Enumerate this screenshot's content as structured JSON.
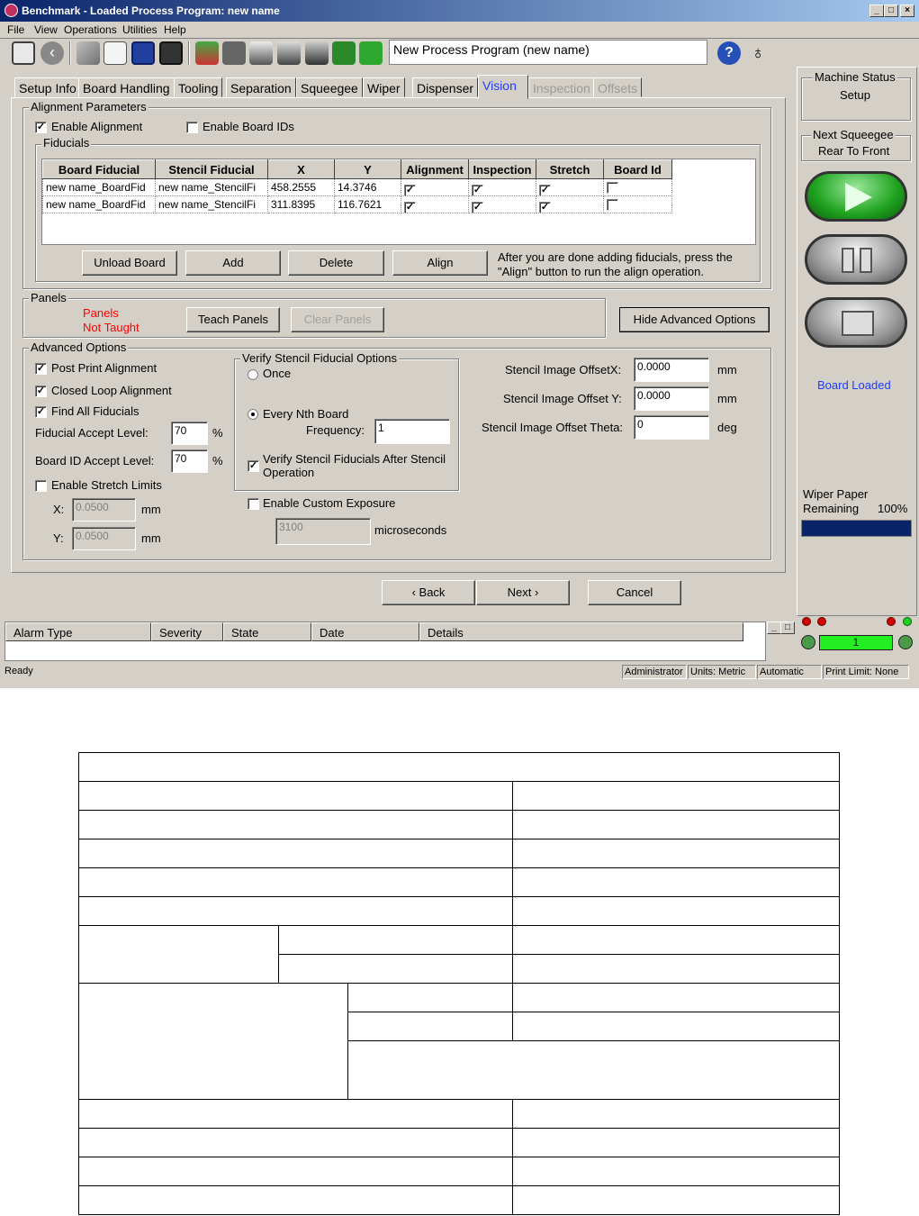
{
  "window": {
    "title": "Benchmark - Loaded Process Program:  new name"
  },
  "menu": [
    "File",
    "View",
    "Operations",
    "Utilities",
    "Help"
  ],
  "toolbar": {
    "process_program_field": "New Process Program (new name)",
    "icons": [
      "monitor-icon",
      "back-arrow-icon",
      "open-folder-icon",
      "notebook-icon",
      "save-icon",
      "save-as-icon",
      "board-icon",
      "tooling-icon",
      "separation-icon",
      "squeegee-icon",
      "dispenser-icon",
      "wiper-icon",
      "recycle-icon",
      "help-icon",
      "tip-lightbulb-icon"
    ]
  },
  "tabs": [
    {
      "label": "Setup Info",
      "state": "normal"
    },
    {
      "label": "Board Handling",
      "state": "normal"
    },
    {
      "label": "Tooling",
      "state": "normal"
    },
    {
      "label": "Separation",
      "state": "normal"
    },
    {
      "label": "Squeegee",
      "state": "normal"
    },
    {
      "label": "Wiper",
      "state": "normal"
    },
    {
      "label": "Dispenser",
      "state": "normal"
    },
    {
      "label": "Vision",
      "state": "active"
    },
    {
      "label": "Inspection",
      "state": "disabled"
    },
    {
      "label": "Offsets",
      "state": "disabled"
    }
  ],
  "alignment": {
    "group_label": "Alignment Parameters",
    "enable_alignment": {
      "label": "Enable Alignment",
      "checked": true
    },
    "enable_board_ids": {
      "label": "Enable Board IDs",
      "checked": false
    },
    "fiducials_label": "Fiducials",
    "columns": [
      "Board Fiducial",
      "Stencil Fiducial",
      "X",
      "Y",
      "Alignment",
      "Inspection",
      "Stretch",
      "Board Id"
    ],
    "rows": [
      {
        "board": "new name_BoardFid",
        "stencil": "new name_StencilFi",
        "x": "458.2555",
        "y": "14.3746",
        "alignment": true,
        "inspection": true,
        "stretch": true,
        "board_id": false
      },
      {
        "board": "new name_BoardFid",
        "stencil": "new name_StencilFi",
        "x": "311.8395",
        "y": "116.7621",
        "alignment": true,
        "inspection": true,
        "stretch": true,
        "board_id": false
      }
    ],
    "buttons": {
      "unload": "Unload Board",
      "add": "Add",
      "delete": "Delete",
      "align": "Align"
    },
    "hint": "After you are done adding fiducials, press the \"Align\" button to run the align operation."
  },
  "panels": {
    "group_label": "Panels",
    "status_line1": "Panels",
    "status_line2": "Not Taught",
    "status_color": "#ff0000",
    "teach_button": "Teach Panels",
    "clear_button": "Clear Panels",
    "hide_advanced_button": "Hide Advanced Options"
  },
  "advanced": {
    "group_label": "Advanced Options",
    "post_print_alignment": {
      "label": "Post Print Alignment",
      "checked": true
    },
    "closed_loop_alignment": {
      "label": "Closed Loop Alignment",
      "checked": true
    },
    "find_all_fiducials": {
      "label": "Find All Fiducials",
      "checked": true
    },
    "fiducial_accept_label": "Fiducial Accept Level:",
    "fiducial_accept_value": "70",
    "board_id_accept_label": "Board ID Accept Level:",
    "board_id_accept_value": "70",
    "percent": "%",
    "enable_stretch_limits": {
      "label": "Enable Stretch Limits",
      "checked": false
    },
    "stretch_x_label": "X:",
    "stretch_x_value": "0.0500",
    "stretch_y_label": "Y:",
    "stretch_y_value": "0.0500",
    "mm": "mm",
    "verify_group_label": "Verify Stencil Fiducial Options",
    "once_label": "Once",
    "every_nth_label": "Every Nth Board",
    "frequency_label": "Frequency:",
    "frequency_value": "1",
    "selected_option": "every_nth",
    "verify_after_label_1": "Verify Stencil Fiducials After Stencil",
    "verify_after_label_2": "Operation",
    "verify_after_checked": true,
    "custom_exposure": {
      "label": "Enable Custom Exposure",
      "checked": false
    },
    "exposure_value": "3100",
    "microseconds": "microseconds",
    "offset_x_label": "Stencil Image OffsetX:",
    "offset_x_value": "0.0000",
    "offset_y_label": "Stencil Image Offset Y:",
    "offset_y_value": "0.0000",
    "offset_theta_label": "Stencil Image Offset Theta:",
    "offset_theta_value": "0",
    "deg": "deg"
  },
  "nav": {
    "back": "‹ Back",
    "next": "Next ›",
    "cancel": "Cancel"
  },
  "sidebar": {
    "machine_status_label": "Machine Status",
    "machine_status_value": "Setup",
    "next_squeegee_label": "Next Squeegee",
    "next_squeegee_value": "Rear To Front",
    "board_status": "Board Loaded",
    "wiper_label_1": "Wiper Paper",
    "wiper_label_2": "Remaining",
    "wiper_percent_text": "100%",
    "wiper_fraction": 1.0,
    "counter_value": "1",
    "colors": {
      "play": "#1fa31f",
      "board_status": "#1f3cff",
      "wiper_bar": "#0a246a",
      "counter": "#22ee22"
    }
  },
  "alarm": {
    "columns": [
      "Alarm Type",
      "Severity",
      "State",
      "Date",
      "Details"
    ]
  },
  "statusbar": {
    "ready": "Ready",
    "user": "Administrator",
    "units": "Units: Metric",
    "mode": "Automatic",
    "print_limit": "Print Limit: None"
  }
}
